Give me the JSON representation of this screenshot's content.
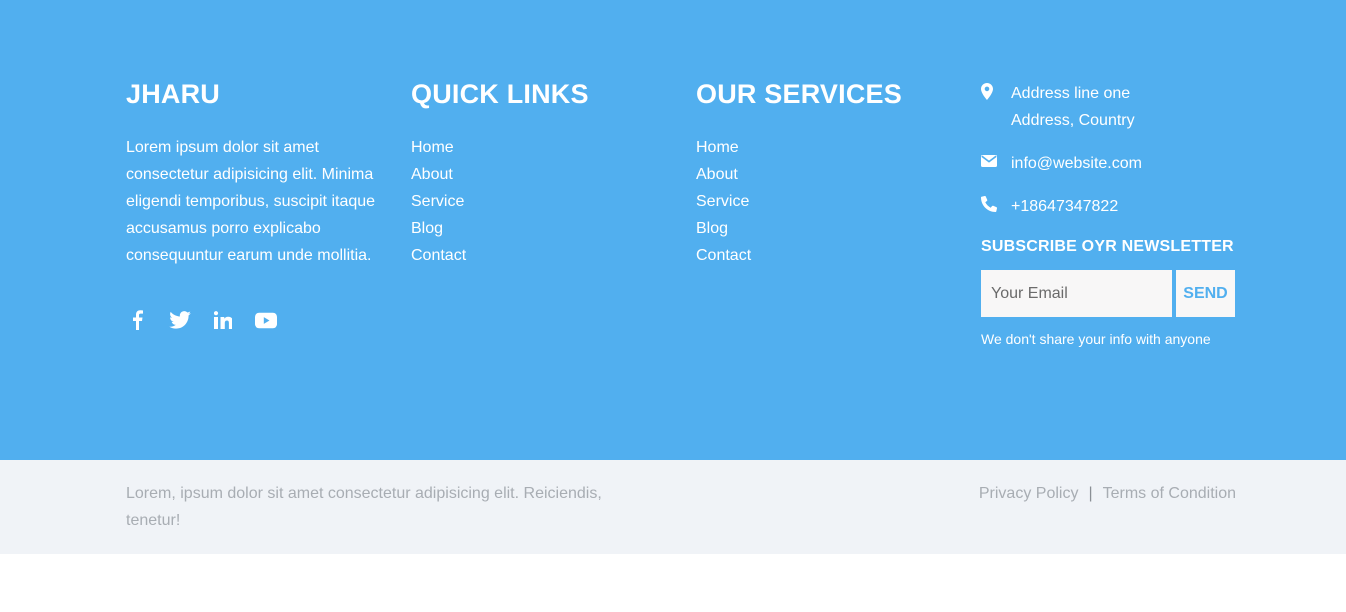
{
  "brand": {
    "title": "JHARU",
    "description": "Lorem ipsum dolor sit amet consectetur adipisicing elit. Minima eligendi temporibus, suscipit itaque accusamus porro explicabo consequuntur earum unde mollitia.",
    "social": [
      "facebook-icon",
      "twitter-icon",
      "linkedin-icon",
      "youtube-icon"
    ]
  },
  "quick_links": {
    "title": "QUICK LINKS",
    "items": [
      "Home",
      "About",
      "Service",
      "Blog",
      "Contact"
    ]
  },
  "services": {
    "title": "OUR SERVICES",
    "items": [
      "Home",
      "About",
      "Service",
      "Blog",
      "Contact"
    ]
  },
  "contact": {
    "address_line1": "Address line one",
    "address_line2": "Address, Country",
    "email": "info@website.com",
    "phone": "+18647347822"
  },
  "newsletter": {
    "title": "SUBSCRIBE OYR NEWSLETTER",
    "placeholder": "Your Email",
    "button": "SEND",
    "note": "We don't share your info with anyone"
  },
  "bottom": {
    "copyright": "Lorem, ipsum dolor sit amet consectetur adipisicing elit. Reiciendis, tenetur!",
    "privacy": "Privacy Policy",
    "separator": "|",
    "terms": "Terms of Condition"
  },
  "colors": {
    "primary": "#51afef",
    "bottom_bg": "#f0f3f7",
    "muted_text": "#a8adb3"
  }
}
